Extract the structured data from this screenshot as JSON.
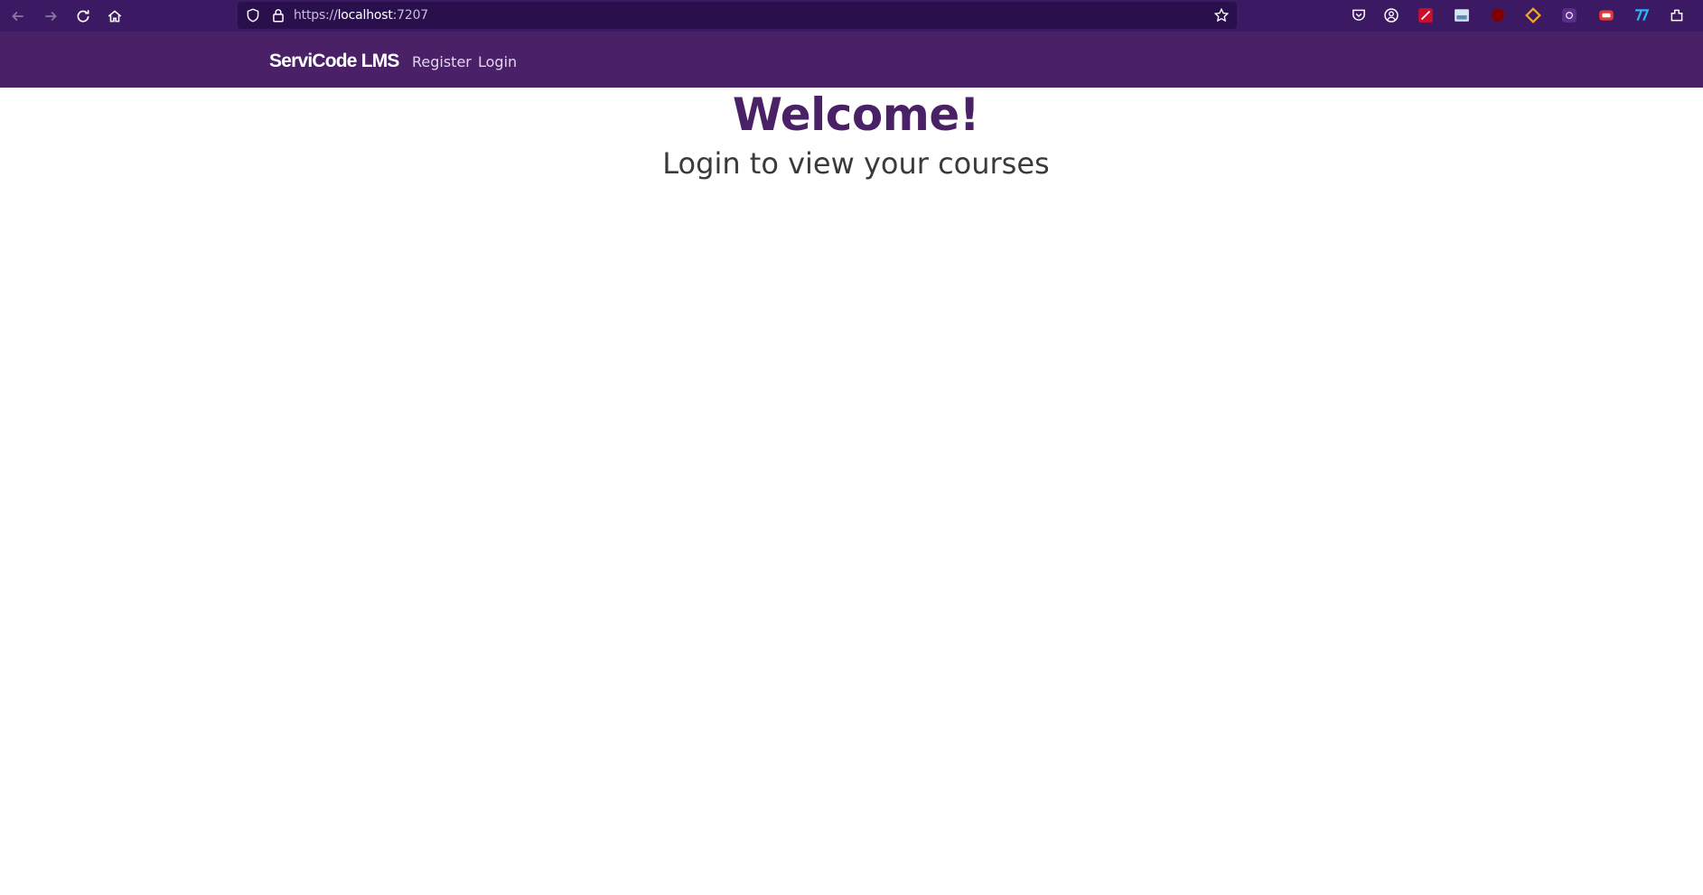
{
  "browser": {
    "url_scheme": "https://",
    "url_host": "localhost",
    "url_port": ":7207",
    "icons": [
      "back-icon",
      "forward-icon",
      "reload-icon",
      "home-icon",
      "shield-icon",
      "lock-icon",
      "star-icon"
    ],
    "extensions": [
      "pocket-icon",
      "account-icon",
      "extension-red-icon",
      "extension-image-icon",
      "ublock-icon",
      "extension-diamond-icon",
      "extension-music-icon",
      "extension-rec-icon",
      "extension-7-icon",
      "extensions-menu-icon"
    ]
  },
  "navbar": {
    "brand": "ServiCode LMS",
    "links": [
      {
        "label": "Register"
      },
      {
        "label": "Login"
      }
    ]
  },
  "main": {
    "title": "Welcome!",
    "subtitle": "Login to view your courses"
  },
  "colors": {
    "browser_toolbar": "#3b1a63",
    "navbar": "#4a2166",
    "accent": "#4a2166"
  }
}
